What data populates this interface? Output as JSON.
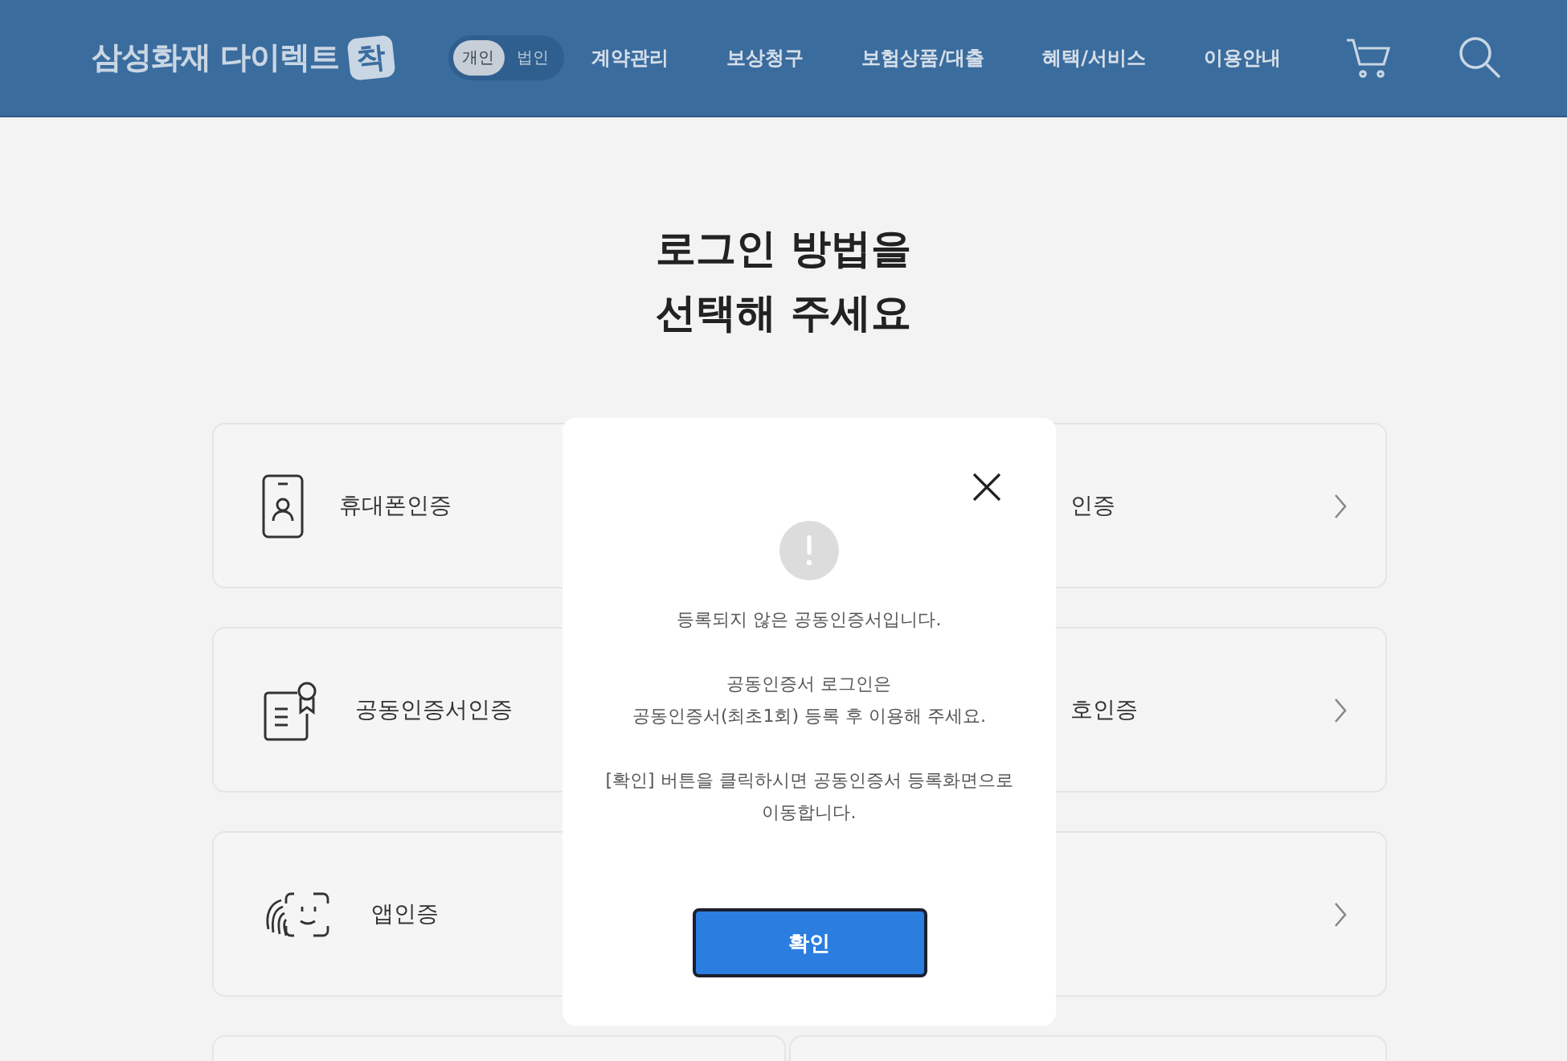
{
  "header": {
    "logo": "삼성화재 다이렉트",
    "logo_badge": "착",
    "customer_types": [
      {
        "label": "개인",
        "selected": true
      },
      {
        "label": "법인",
        "selected": false
      }
    ],
    "nav": [
      "계약관리",
      "보상청구",
      "보험상품/대출",
      "혜택/서비스",
      "이용안내"
    ]
  },
  "title_lines": [
    "로그인 방법을",
    "선택해 주세요"
  ],
  "left_methods": [
    {
      "kind": "phone",
      "label": "휴대폰인증"
    },
    {
      "kind": "certificate",
      "label": "공동인증서인증"
    },
    {
      "kind": "face",
      "label": "앱인증"
    },
    {
      "kind": "blank"
    }
  ],
  "right_methods": [
    {
      "label": "인증"
    },
    {
      "label": "호인증"
    },
    {
      "kind": "arrow"
    },
    {
      "kind": "blank"
    }
  ],
  "dialog": {
    "paragraphs": [
      [
        "등록되지 않은 공동인증서입니다."
      ],
      [
        "공동인증서 로그인은",
        "공동인증서(최초1회) 등록 후 이용해 주세요."
      ],
      [
        "[확인] 버튼을 클릭하시면 공동인증서 등록화면으로",
        "이동합니다."
      ]
    ],
    "confirm": "확인"
  }
}
